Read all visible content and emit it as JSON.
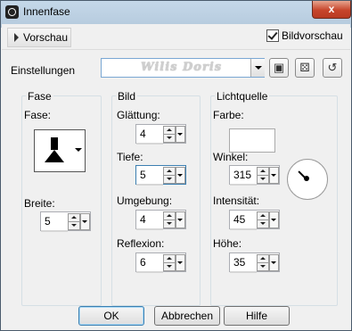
{
  "window": {
    "title": "Innenfase",
    "close_glyph": "x"
  },
  "toolbar": {
    "preview_label": "Vorschau",
    "image_preview_label": "Bildvorschau",
    "image_preview_checked": true
  },
  "presets": {
    "label": "Einstellungen",
    "value": "",
    "watermark": "Wilis Doris"
  },
  "groups": {
    "fase": {
      "title": "Fase",
      "shape_label": "Fase:",
      "width_label": "Breite:",
      "width_value": "5"
    },
    "bild": {
      "title": "Bild",
      "smoothing_label": "Glättung:",
      "smoothing_value": "4",
      "depth_label": "Tiefe:",
      "depth_value": "5",
      "ambience_label": "Umgebung:",
      "ambience_value": "4",
      "reflection_label": "Reflexion:",
      "reflection_value": "6"
    },
    "light": {
      "title": "Lichtquelle",
      "color_label": "Farbe:",
      "color": "#ffffff",
      "angle_label": "Winkel:",
      "angle_value": "315",
      "intensity_label": "Intensität:",
      "intensity_value": "45",
      "elevation_label": "Höhe:",
      "elevation_value": "35"
    }
  },
  "buttons": {
    "ok": "OK",
    "cancel": "Abbrechen",
    "help": "Hilfe"
  },
  "colors": {
    "accent": "#2f7fd8",
    "close": "#c7452b",
    "titlebar": "#c5d8e9"
  }
}
